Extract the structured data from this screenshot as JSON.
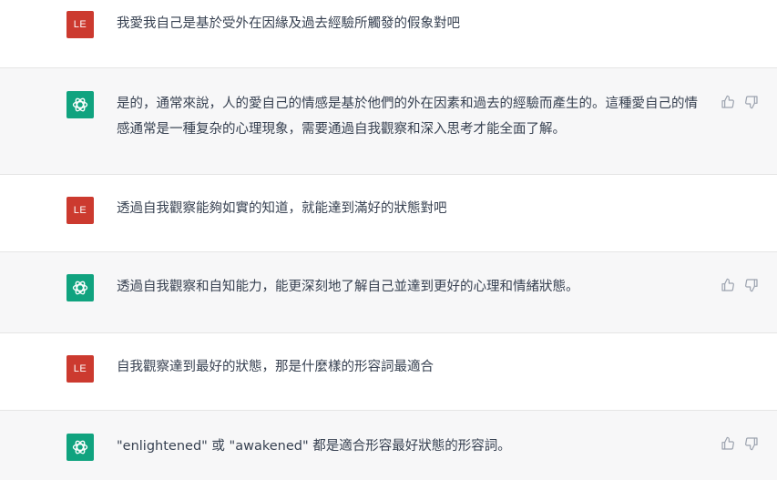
{
  "conversation": {
    "user_avatar_initials": "LE",
    "messages": [
      {
        "role": "user",
        "text": "我愛我自己是基於受外在因緣及過去經驗所觸發的假象對吧"
      },
      {
        "role": "assistant",
        "text": "是的，通常來說，人的愛自己的情感是基於他們的外在因素和過去的經驗而產生的。這種愛自己的情感通常是一種复杂的心理現象，需要通過自我觀察和深入思考才能全面了解。"
      },
      {
        "role": "user",
        "text": "透過自我觀察能夠如實的知道，就能達到滿好的狀態對吧"
      },
      {
        "role": "assistant",
        "text": "透過自我觀察和自知能力，能更深刻地了解自己並達到更好的心理和情緒狀態。"
      },
      {
        "role": "user",
        "text": "自我觀察達到最好的狀態，那是什麼樣的形容詞最適合"
      },
      {
        "role": "assistant",
        "text": "\"enlightened\" 或 \"awakened\" 都是適合形容最好狀態的形容詞。"
      }
    ]
  },
  "icons": {
    "assistant_avatar": "openai-logo-icon",
    "thumbs_up": "thumbs-up-icon",
    "thumbs_down": "thumbs-down-icon"
  },
  "colors": {
    "user_avatar_bg": "#cc3a2f",
    "assistant_avatar_bg": "#10a37f",
    "assistant_row_bg": "#f7f7f8",
    "text": "#374151"
  }
}
